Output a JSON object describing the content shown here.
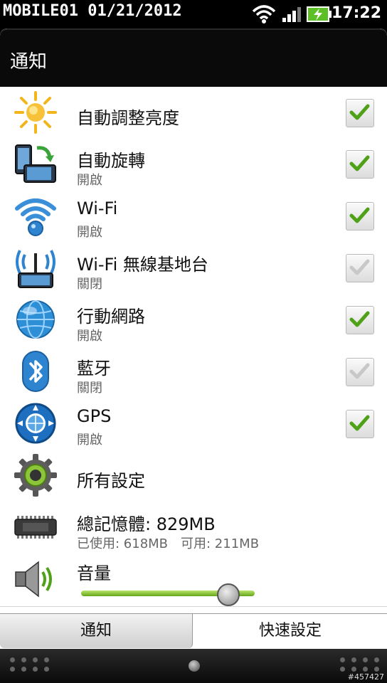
{
  "status_bar": {
    "watermark": "MOBILE01 01/21/2012",
    "time": "17:22",
    "icons": [
      "wifi-icon",
      "signal-icon",
      "battery-charging-icon"
    ]
  },
  "header": {
    "title": "通知"
  },
  "rows": [
    {
      "title": "自動調整亮度",
      "subtitle": "",
      "icon": "brightness-sun-icon",
      "checked": true
    },
    {
      "title": "自動旋轉",
      "subtitle": "開啟",
      "icon": "rotate-phone-icon",
      "checked": true
    },
    {
      "title": "Wi-Fi",
      "subtitle": "開啟",
      "icon": "wifi-icon",
      "checked": true
    },
    {
      "title": "Wi-Fi 無線基地台",
      "subtitle": "關閉",
      "icon": "wifi-hotspot-icon",
      "checked": false
    },
    {
      "title": "行動網路",
      "subtitle": "開啟",
      "icon": "mobile-network-globe-icon",
      "checked": true
    },
    {
      "title": "藍牙",
      "subtitle": "關閉",
      "icon": "bluetooth-icon",
      "checked": false
    },
    {
      "title": "GPS",
      "subtitle": "開啟",
      "icon": "gps-compass-icon",
      "checked": true
    },
    {
      "title": "所有設定",
      "subtitle": "",
      "icon": "gear-icon"
    },
    {
      "title": "總記憶體: 829MB",
      "subtitle": "已使用: 618MB　可用: 211MB",
      "icon": "memory-chip-icon"
    },
    {
      "title": "音量",
      "subtitle": "",
      "icon": "speaker-icon",
      "volume_level": 0.85
    }
  ],
  "tabs": {
    "notifications": "通知",
    "quick_settings": "快速設定"
  },
  "bottom_bar": {
    "watermark_id": "#457427"
  },
  "colors": {
    "check_green": "#4fa118",
    "check_grey": "#c8c8c8",
    "slider_green": "#7fc127"
  }
}
